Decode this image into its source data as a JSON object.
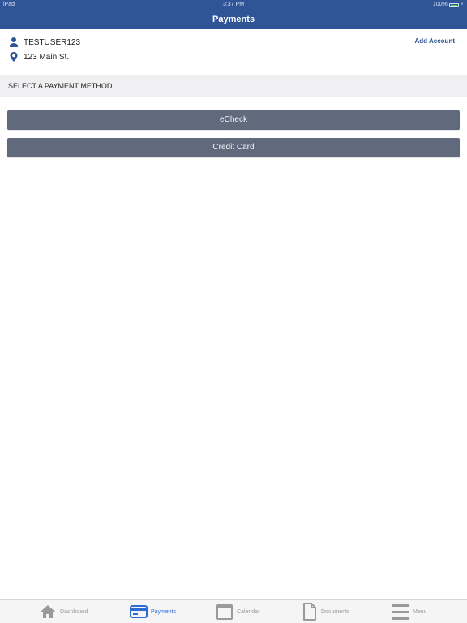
{
  "status_bar": {
    "device": "iPad",
    "time": "3:37 PM",
    "battery": "100%"
  },
  "nav": {
    "title": "Payments"
  },
  "account": {
    "username": "TESTUSER123",
    "address": "123 Main St.",
    "add_account_label": "Add Account"
  },
  "section": {
    "header": "SELECT A PAYMENT METHOD"
  },
  "payment_methods": [
    {
      "label": "eCheck"
    },
    {
      "label": "Credit Card"
    }
  ],
  "tabs": [
    {
      "label": "Dashboard",
      "icon": "home-icon",
      "active": false
    },
    {
      "label": "Payments",
      "icon": "credit-card-icon",
      "active": true
    },
    {
      "label": "Calendar",
      "icon": "calendar-icon",
      "active": false
    },
    {
      "label": "Documents",
      "icon": "document-icon",
      "active": false
    },
    {
      "label": "Menu",
      "icon": "hamburger-menu-icon",
      "active": false
    }
  ],
  "colors": {
    "brand_blue": "#2f5597",
    "button_gray": "#606a7c",
    "active_tab": "#2f6bd6",
    "inactive_tab": "#9a9a9a"
  }
}
